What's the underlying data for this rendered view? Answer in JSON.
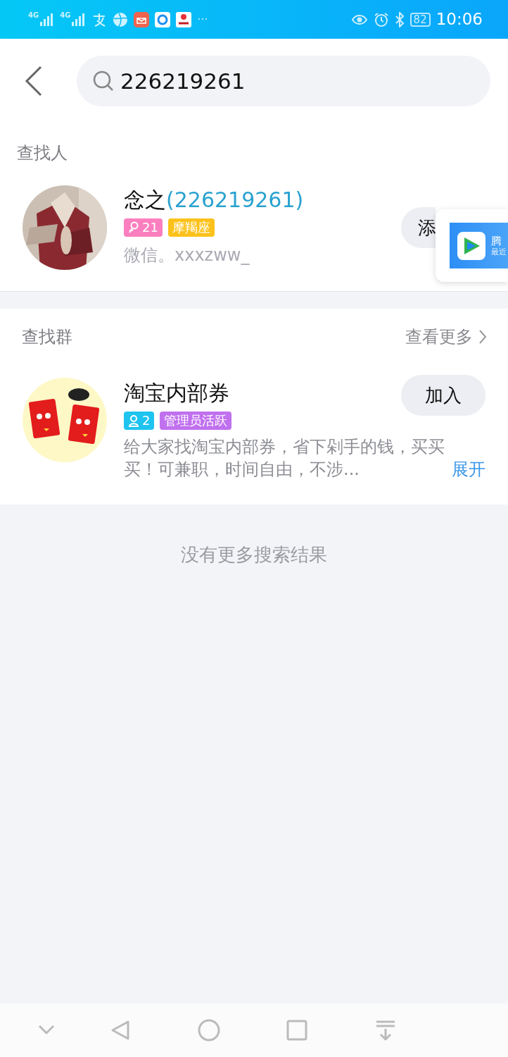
{
  "status_bar": {
    "network_labels": [
      "4G",
      "4G"
    ],
    "more": "···",
    "battery": "82",
    "time": "10:06"
  },
  "search": {
    "value": "226219261"
  },
  "people_section": {
    "title": "查找人",
    "results": [
      {
        "name": "念之",
        "account": "(226219261)",
        "tags": [
          {
            "kind": "gender",
            "text": "21",
            "color": "#fb7fbf"
          },
          {
            "kind": "plain",
            "text": "摩羯座",
            "color": "#fcc21b"
          }
        ],
        "subtitle": "微信。xxxzww_",
        "button": "添"
      }
    ]
  },
  "popup": {
    "title": "腾",
    "subtitle": "最近"
  },
  "group_section": {
    "title": "查找群",
    "more_link": "查看更多",
    "results": [
      {
        "name": "淘宝内部券",
        "tags": [
          {
            "kind": "members",
            "text": "2",
            "color": "#1ec3ef"
          },
          {
            "kind": "plain",
            "text": "管理员活跃",
            "color": "#c070ee"
          }
        ],
        "description": "给大家找淘宝内部券，省下剁手的钱，买买买！可兼职，时间自由，不涉...",
        "expand": "展开",
        "button": "加入"
      }
    ]
  },
  "footer": "没有更多搜索结果"
}
